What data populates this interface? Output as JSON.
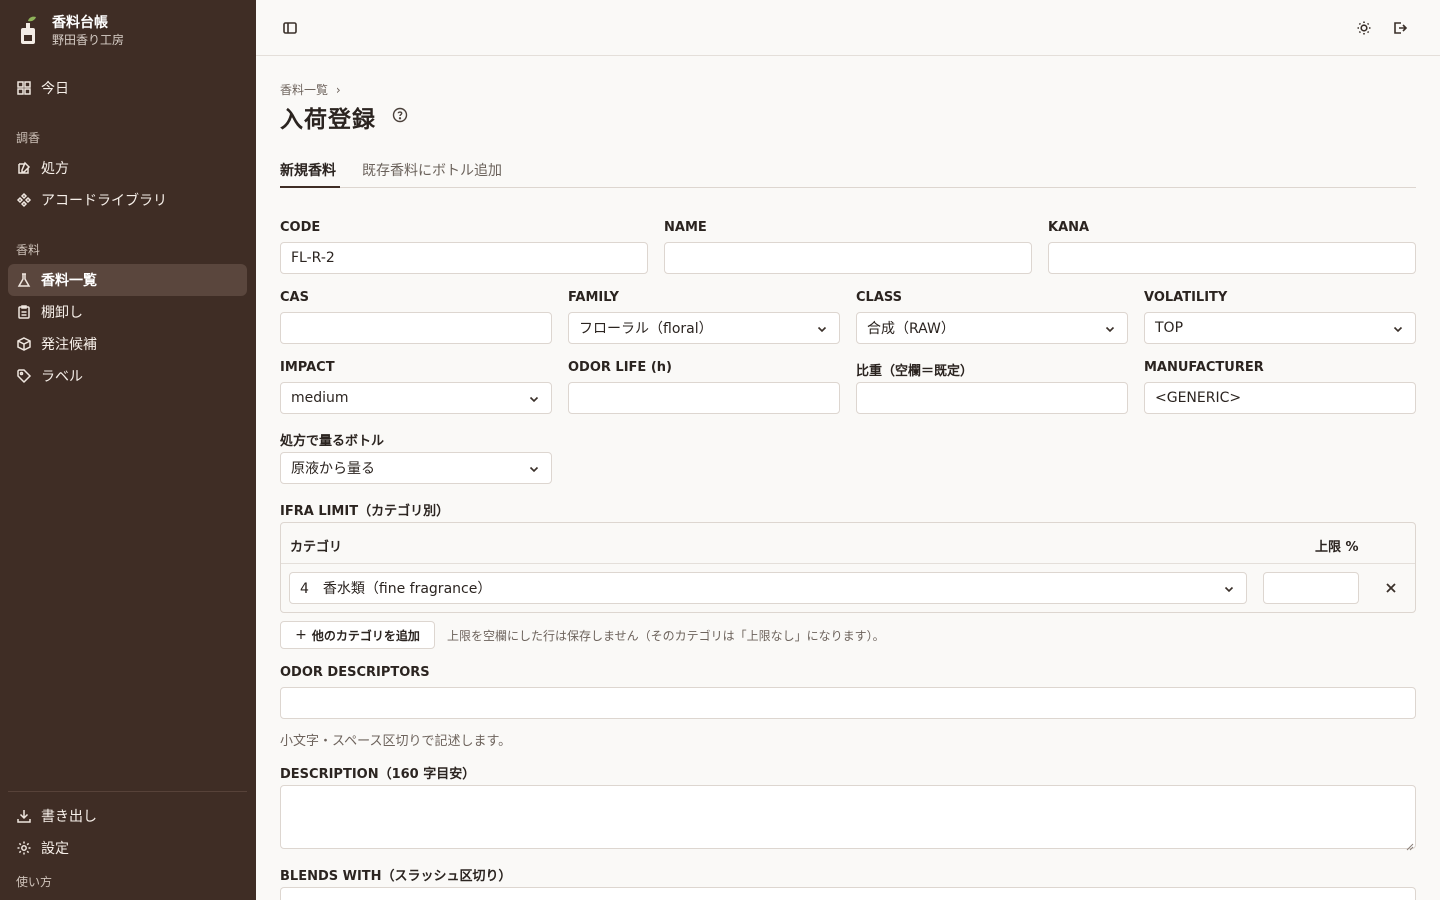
{
  "brand": {
    "title": "香料台帳",
    "subtitle": "野田香り工房"
  },
  "sidebar": {
    "today": "今日",
    "section_chouko": "調香",
    "formula": "処方",
    "accord_library": "アコードライブラリ",
    "section_koryo": "香料",
    "material_list": "香料一覧",
    "stocktake": "棚卸し",
    "order_candidates": "発注候補",
    "labels": "ラベル",
    "export": "書き出し",
    "settings": "設定",
    "howto": "使い方"
  },
  "breadcrumb": {
    "parent": "香料一覧",
    "sep": "›"
  },
  "page": {
    "title": "入荷登録"
  },
  "tabs": {
    "new_material": "新規香料",
    "add_bottle": "既存香料にボトル追加"
  },
  "form": {
    "code": {
      "label": "CODE",
      "value": "FL-R-2"
    },
    "name": {
      "label": "NAME",
      "value": ""
    },
    "kana": {
      "label": "KANA",
      "value": ""
    },
    "cas": {
      "label": "CAS",
      "value": ""
    },
    "family": {
      "label": "FAMILY",
      "value": "フローラル（floral）"
    },
    "class": {
      "label": "CLASS",
      "value": "合成（RAW）"
    },
    "volatility": {
      "label": "VOLATILITY",
      "value": "TOP"
    },
    "impact": {
      "label": "IMPACT",
      "value": "medium"
    },
    "odor_life": {
      "label": "ODOR LIFE (h)",
      "value": ""
    },
    "specific_gravity": {
      "label": "比重（空欄＝既定）",
      "value": ""
    },
    "manufacturer": {
      "label": "MANUFACTURER",
      "value": "<GENERIC>"
    },
    "bottle": {
      "label": "処方で量るボトル",
      "value": "原液から量る"
    },
    "ifra": {
      "label": "IFRA LIMIT（カテゴリ別）",
      "col_category": "カテゴリ",
      "col_limit": "上限 %",
      "row_category": "4　香水類（fine fragrance）",
      "row_limit": "",
      "add_button": "他のカテゴリを追加",
      "hint": "上限を空欄にした行は保存しません（そのカテゴリは「上限なし」になります）。"
    },
    "odor_descriptors": {
      "label": "ODOR DESCRIPTORS",
      "value": "",
      "hint": "小文字・スペース区切りで記述します。"
    },
    "description": {
      "label": "DESCRIPTION（160 字目安）",
      "value": ""
    },
    "blends_with": {
      "label": "BLENDS WITH（スラッシュ区切り）"
    }
  }
}
